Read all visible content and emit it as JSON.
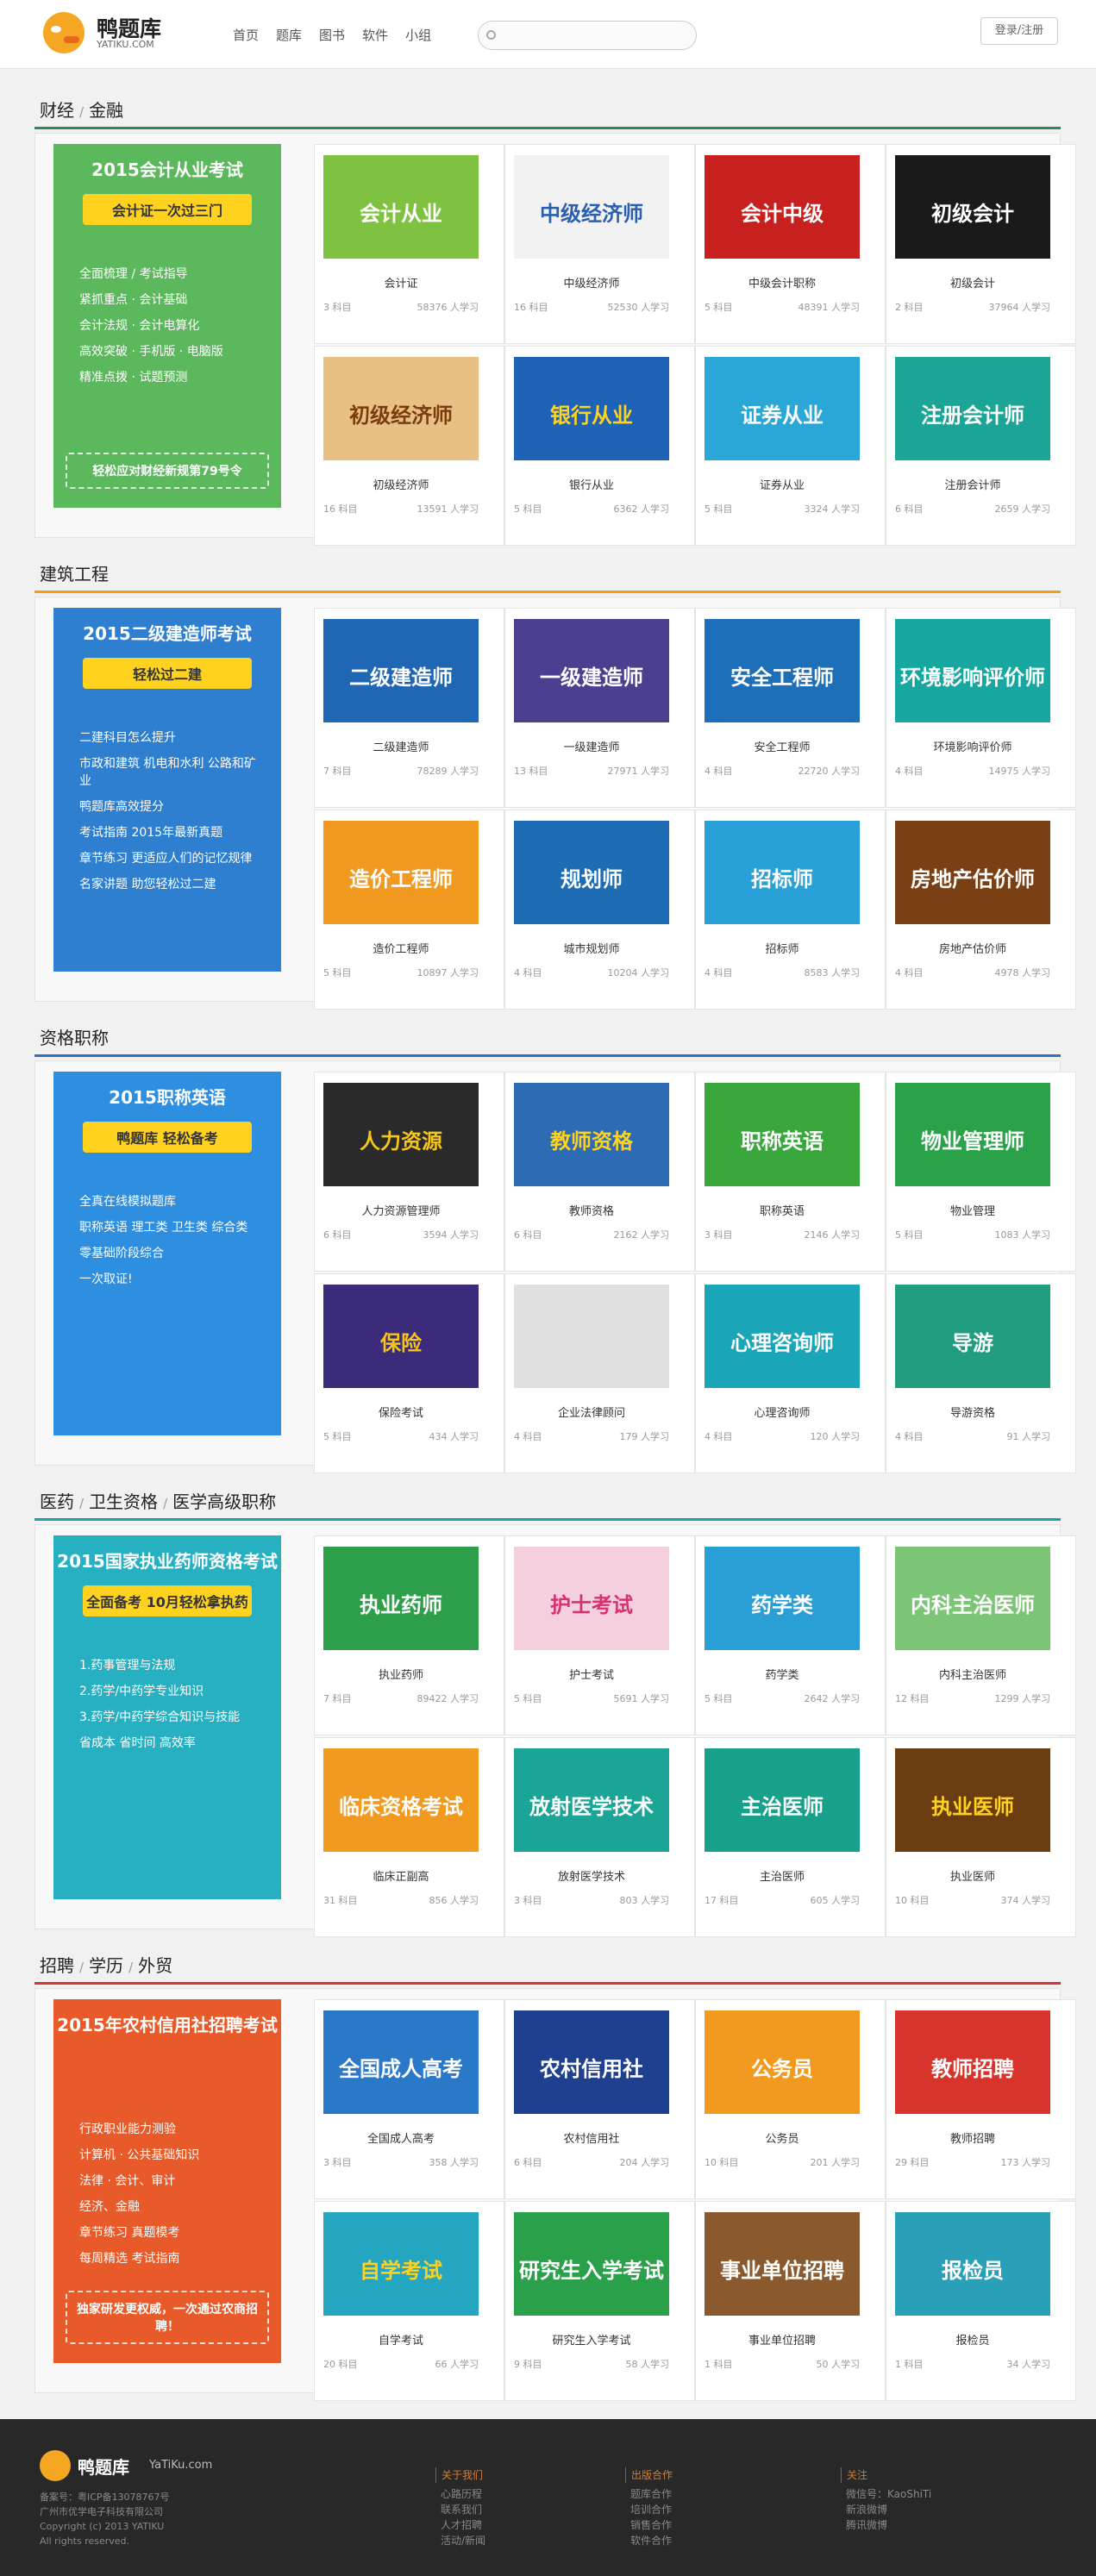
{
  "header": {
    "logo_cn": "鸭题库",
    "logo_en": "YATIKU.COM",
    "nav": [
      "首页",
      "题库",
      "图书",
      "软件",
      "小组"
    ],
    "search_placeholder": "",
    "login": "登录/注册"
  },
  "sections": [
    {
      "title_parts": [
        "财经",
        "金融"
      ],
      "line_color": "#2e8b57",
      "promo": {
        "bg": "#5cb85c",
        "title": "2015会计从业考试",
        "subtitle": "会计证一次过三门",
        "lines": [
          "全面梳理 / 考试指导",
          "紧抓重点 · 会计基础",
          "会计法规 · 会计电算化",
          "高效突破 · 手机版 · 电脑版",
          "精准点拨 · 试题预测"
        ],
        "footer": "轻松应对财经新规第79号令"
      },
      "courses": [
        {
          "name": "会计证",
          "subjects": "3 科目",
          "learners": "58376 人学习",
          "title": "会计从业",
          "bg": "#7fc241",
          "fg": "#fff"
        },
        {
          "name": "中级经济师",
          "subjects": "16 科目",
          "learners": "52530 人学习",
          "title": "中级经济师",
          "bg": "#f2f2f2",
          "fg": "#2b5fb0"
        },
        {
          "name": "中级会计职称",
          "subjects": "5 科目",
          "learners": "48391 人学习",
          "title": "会计中级",
          "bg": "#c8201e",
          "fg": "#fff"
        },
        {
          "name": "初级会计",
          "subjects": "2 科目",
          "learners": "37964 人学习",
          "title": "初级会计",
          "bg": "#1a1a1a",
          "fg": "#fff"
        },
        {
          "name": "初级经济师",
          "subjects": "16 科目",
          "learners": "13591 人学习",
          "title": "初级经济师",
          "bg": "#e9c083",
          "fg": "#7a3d10"
        },
        {
          "name": "银行从业",
          "subjects": "5 科目",
          "learners": "6362 人学习",
          "title": "银行从业",
          "bg": "#1e63b6",
          "fg": "#ffd21f"
        },
        {
          "name": "证券从业",
          "subjects": "5 科目",
          "learners": "3324 人学习",
          "title": "证券从业",
          "bg": "#2aa7d6",
          "fg": "#fff"
        },
        {
          "name": "注册会计师",
          "subjects": "6 科目",
          "learners": "2659 人学习",
          "title": "注册会计师",
          "bg": "#1aa596",
          "fg": "#fff"
        }
      ]
    },
    {
      "title_parts": [
        "建筑工程"
      ],
      "line_color": "#f39c12",
      "promo": {
        "bg": "#2e7fd0",
        "title": "2015二级建造师考试",
        "subtitle": "轻松过二建",
        "lines": [
          "二建科目怎么提升",
          "市政和建筑  机电和水利  公路和矿业",
          "鸭题库高效提分",
          "考试指南 2015年最新真题",
          "章节练习 更适应人们的记忆规律",
          "名家讲题 助您轻松过二建"
        ],
        "footer": ""
      },
      "courses": [
        {
          "name": "二级建造师",
          "subjects": "7 科目",
          "learners": "78289 人学习",
          "title": "二级建造师",
          "bg": "#1f66b4",
          "fg": "#fff"
        },
        {
          "name": "一级建造师",
          "subjects": "13 科目",
          "learners": "27971 人学习",
          "title": "一级建造师",
          "bg": "#4b3f8f",
          "fg": "#fff"
        },
        {
          "name": "安全工程师",
          "subjects": "4 科目",
          "learners": "22720 人学习",
          "title": "安全工程师",
          "bg": "#1e6fb9",
          "fg": "#fff"
        },
        {
          "name": "环境影响评价师",
          "subjects": "4 科目",
          "learners": "14975 人学习",
          "title": "环境影响评价师",
          "bg": "#15a7a0",
          "fg": "#fff"
        },
        {
          "name": "造价工程师",
          "subjects": "5 科目",
          "learners": "10897 人学习",
          "title": "造价工程师",
          "bg": "#f29a1f",
          "fg": "#fff"
        },
        {
          "name": "城市规划师",
          "subjects": "4 科目",
          "learners": "10204 人学习",
          "title": "规划师",
          "bg": "#1d6cb4",
          "fg": "#fff"
        },
        {
          "name": "招标师",
          "subjects": "4 科目",
          "learners": "8583 人学习",
          "title": "招标师",
          "bg": "#2aa0d8",
          "fg": "#fff"
        },
        {
          "name": "房地产估价师",
          "subjects": "4 科目",
          "learners": "4978 人学习",
          "title": "房地产估价师",
          "bg": "#7a3f12",
          "fg": "#fff"
        }
      ]
    },
    {
      "title_parts": [
        "资格职称"
      ],
      "line_color": "#2a72c8",
      "promo": {
        "bg": "#2e8ee0",
        "title": "2015职称英语",
        "subtitle": "鸭题库 轻松备考",
        "lines": [
          "全真在线模拟题库",
          "职称英语 理工类 卫生类 综合类",
          "零基础阶段综合",
          "一次取证!"
        ],
        "footer": ""
      },
      "courses": [
        {
          "name": "人力资源管理师",
          "subjects": "6 科目",
          "learners": "3594 人学习",
          "title": "人力资源",
          "bg": "#2a2a2a",
          "fg": "#f5c518"
        },
        {
          "name": "教师资格",
          "subjects": "6 科目",
          "learners": "2162 人学习",
          "title": "教师资格",
          "bg": "#2d6bb5",
          "fg": "#ffd21f"
        },
        {
          "name": "职称英语",
          "subjects": "3 科目",
          "learners": "2146 人学习",
          "title": "职称英语",
          "bg": "#3aa73c",
          "fg": "#fff"
        },
        {
          "name": "物业管理",
          "subjects": "5 科目",
          "learners": "1083 人学习",
          "title": "物业管理师",
          "bg": "#2aa24a",
          "fg": "#fff"
        },
        {
          "name": "保险考试",
          "subjects": "5 科目",
          "learners": "434 人学习",
          "title": "保险",
          "bg": "#3c2a7a",
          "fg": "#f5c518"
        },
        {
          "name": "企业法律顾问",
          "subjects": "4 科目",
          "learners": "179 人学习",
          "title": "",
          "bg": "#e0e0e0",
          "fg": "#333"
        },
        {
          "name": "心理咨询师",
          "subjects": "4 科目",
          "learners": "120 人学习",
          "title": "心理咨询师",
          "bg": "#1ba5b8",
          "fg": "#fff"
        },
        {
          "name": "导游资格",
          "subjects": "4 科目",
          "learners": "91 人学习",
          "title": "导游",
          "bg": "#1f9d7e",
          "fg": "#fff"
        }
      ]
    },
    {
      "title_parts": [
        "医药",
        "卫生资格",
        "医学高级职称"
      ],
      "line_color": "#1aa1b0",
      "promo": {
        "bg": "#27b0c2",
        "title": "2015国家执业药师资格考试",
        "subtitle": "全面备考 10月轻松拿执药",
        "lines": [
          "1.药事管理与法规",
          "2.药学/中药学专业知识",
          "3.药学/中药学综合知识与技能",
          "省成本  省时间  高效率"
        ],
        "footer": ""
      },
      "courses": [
        {
          "name": "执业药师",
          "subjects": "7 科目",
          "learners": "89422 人学习",
          "title": "执业药师",
          "bg": "#2d9e4a",
          "fg": "#fff"
        },
        {
          "name": "护士考试",
          "subjects": "5 科目",
          "learners": "5691 人学习",
          "title": "护士考试",
          "bg": "#f4d0de",
          "fg": "#d6336c"
        },
        {
          "name": "药学类",
          "subjects": "5 科目",
          "learners": "2642 人学习",
          "title": "药学类",
          "bg": "#2a9fd6",
          "fg": "#fff"
        },
        {
          "name": "内科主治医师",
          "subjects": "12 科目",
          "learners": "1299 人学习",
          "title": "内科主治医师",
          "bg": "#7cc576",
          "fg": "#fff"
        },
        {
          "name": "临床正副高",
          "subjects": "31 科目",
          "learners": "856 人学习",
          "title": "临床资格考试",
          "bg": "#f29a1f",
          "fg": "#fff"
        },
        {
          "name": "放射医学技术",
          "subjects": "3 科目",
          "learners": "803 人学习",
          "title": "放射医学技术",
          "bg": "#1aa596",
          "fg": "#fff"
        },
        {
          "name": "主治医师",
          "subjects": "17 科目",
          "learners": "605 人学习",
          "title": "主治医师",
          "bg": "#17a08a",
          "fg": "#fff"
        },
        {
          "name": "执业医师",
          "subjects": "10 科目",
          "learners": "374 人学习",
          "title": "执业医师",
          "bg": "#6b3b12",
          "fg": "#ffd21f"
        }
      ]
    },
    {
      "title_parts": [
        "招聘",
        "学历",
        "外贸"
      ],
      "line_color": "#d9342b",
      "promo": {
        "bg": "#e85a2a",
        "title": "2015年农村信用社招聘考试",
        "subtitle": "",
        "lines": [
          "行政职业能力测验",
          "计算机 · 公共基础知识",
          "法律 · 会计、审计",
          "经济、金融",
          "章节练习 真题模考",
          "每周精选 考试指南"
        ],
        "footer": "独家研发更权威，一次通过农商招聘！"
      },
      "courses": [
        {
          "name": "全国成人高考",
          "subjects": "3 科目",
          "learners": "358 人学习",
          "title": "全国成人高考",
          "bg": "#2a78c8",
          "fg": "#fff"
        },
        {
          "name": "农村信用社",
          "subjects": "6 科目",
          "learners": "204 人学习",
          "title": "农村信用社",
          "bg": "#1f3f8f",
          "fg": "#fff"
        },
        {
          "name": "公务员",
          "subjects": "10 科目",
          "learners": "201 人学习",
          "title": "公务员",
          "bg": "#f29a1f",
          "fg": "#fff"
        },
        {
          "name": "教师招聘",
          "subjects": "29 科目",
          "learners": "173 人学习",
          "title": "教师招聘",
          "bg": "#d9342b",
          "fg": "#fff"
        },
        {
          "name": "自学考试",
          "subjects": "20 科目",
          "learners": "66 人学习",
          "title": "自学考试",
          "bg": "#25a6c0",
          "fg": "#ffd21f"
        },
        {
          "name": "研究生入学考试",
          "subjects": "9 科目",
          "learners": "58 人学习",
          "title": "研究生入学考试",
          "bg": "#2aa04a",
          "fg": "#fff"
        },
        {
          "name": "事业单位招聘",
          "subjects": "1 科目",
          "learners": "50 人学习",
          "title": "事业单位招聘",
          "bg": "#8a5a2e",
          "fg": "#fff"
        },
        {
          "name": "报检员",
          "subjects": "1 科目",
          "learners": "34 人学习",
          "title": "报检员",
          "bg": "#2aa0b8",
          "fg": "#fff"
        }
      ]
    }
  ],
  "footer": {
    "brand": "鸭题库",
    "brand_en": "YaTiKu.com",
    "info": [
      "备案号：粤ICP备13078767号",
      "广州市优学电子科技有限公司",
      "Copyright (c) 2013 YATIKU",
      "All rights reserved."
    ],
    "col1": {
      "head": "关于我们",
      "items": [
        "心路历程",
        "联系我们",
        "人才招聘",
        "活动/新闻"
      ]
    },
    "col2": {
      "head": "出版合作",
      "items": [
        "题库合作",
        "培训合作",
        "销售合作",
        "软件合作"
      ]
    },
    "col3": {
      "head": "关注",
      "items": [
        "微信号：KaoShiTi",
        "新浪微博",
        "腾讯微博"
      ]
    }
  }
}
